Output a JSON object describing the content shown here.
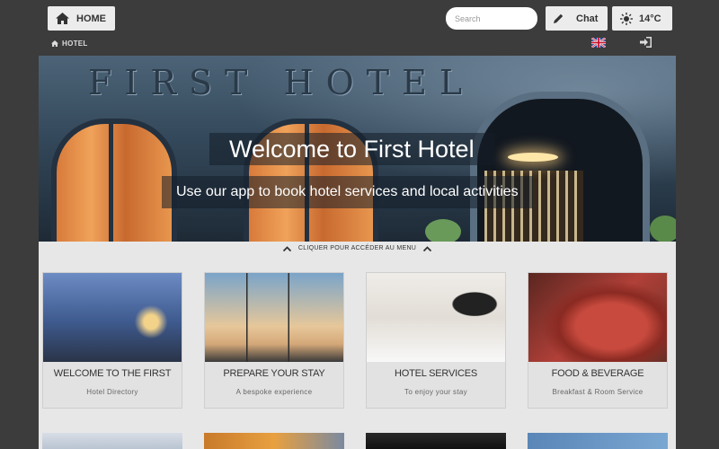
{
  "header": {
    "home_label": "HOME",
    "search_placeholder": "Search",
    "chat_label": "Chat",
    "weather_temp": "14°C",
    "breadcrumb": "HOTEL",
    "icons": {
      "home": "home-icon",
      "chat": "pencil-icon",
      "weather": "sun-icon",
      "language": "uk-flag-icon",
      "login": "login-icon"
    }
  },
  "hero": {
    "title": "Welcome to First Hotel",
    "subtitle": "Use our app to book hotel services and local activities",
    "sign_text": "FIRST HOTEL"
  },
  "menu_toggle": "CLIQUER POUR ACCÉDER AU MENU",
  "cards": [
    {
      "title": "WELCOME TO THE FIRST",
      "subtitle": "Hotel Directory"
    },
    {
      "title": "PREPARE YOUR STAY",
      "subtitle": "A bespoke experience"
    },
    {
      "title": "HOTEL SERVICES",
      "subtitle": "To enjoy your stay"
    },
    {
      "title": "FOOD & BEVERAGE",
      "subtitle": "Breakfast & Room Service"
    }
  ],
  "colors": {
    "page_bg": "#3c3c3c",
    "panel_bg": "#e7e7e7",
    "button_bg": "#ececec"
  }
}
